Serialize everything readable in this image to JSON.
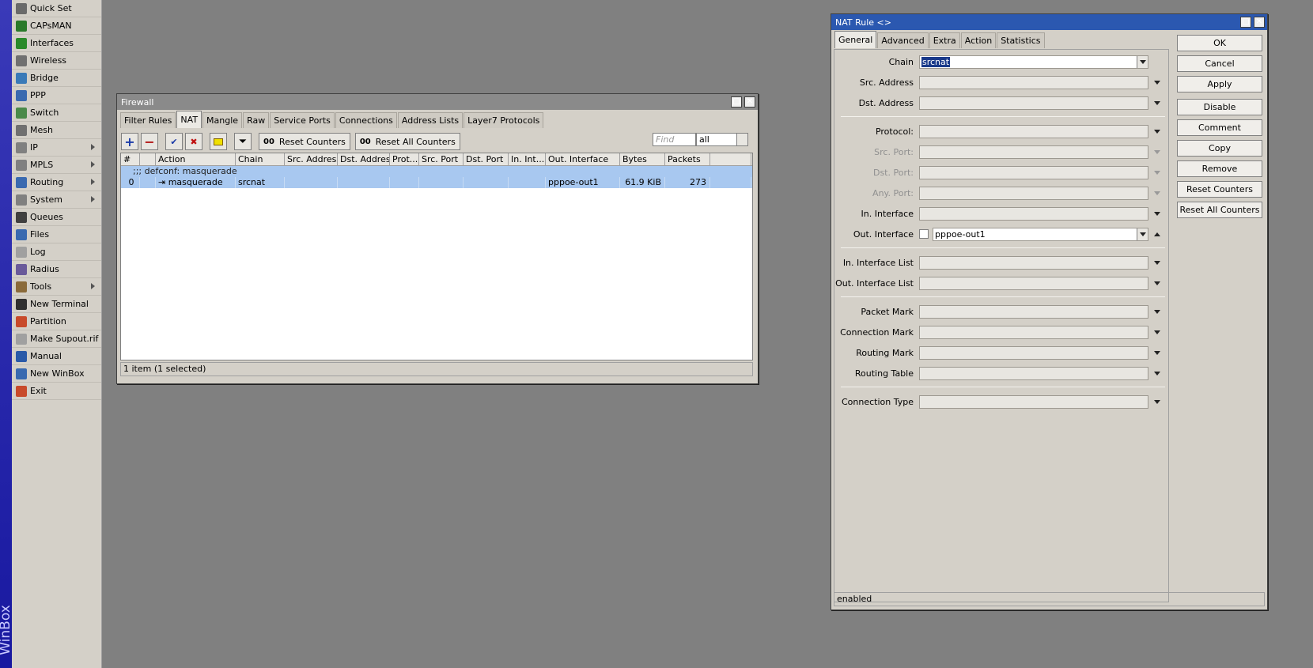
{
  "app": {
    "brand": "WinBox"
  },
  "sidebar": {
    "items": [
      {
        "label": "Quick Set",
        "icon": "quick-set-icon",
        "color": "#6a6a6a",
        "sub": false
      },
      {
        "label": "CAPsMAN",
        "icon": "capsman-icon",
        "color": "#2a7a2a",
        "sub": false
      },
      {
        "label": "Interfaces",
        "icon": "interfaces-icon",
        "color": "#2a8a2a",
        "sub": false
      },
      {
        "label": "Wireless",
        "icon": "wireless-icon",
        "color": "#707070",
        "sub": false
      },
      {
        "label": "Bridge",
        "icon": "bridge-icon",
        "color": "#3a7ab8",
        "sub": false
      },
      {
        "label": "PPP",
        "icon": "ppp-icon",
        "color": "#3a6ab0",
        "sub": false
      },
      {
        "label": "Switch",
        "icon": "switch-icon",
        "color": "#4a8a4a",
        "sub": false
      },
      {
        "label": "Mesh",
        "icon": "mesh-icon",
        "color": "#707070",
        "sub": false
      },
      {
        "label": "IP",
        "icon": "ip-icon",
        "color": "#808080",
        "sub": true
      },
      {
        "label": "MPLS",
        "icon": "mpls-icon",
        "color": "#808080",
        "sub": true
      },
      {
        "label": "Routing",
        "icon": "routing-icon",
        "color": "#3a6ab0",
        "sub": true
      },
      {
        "label": "System",
        "icon": "system-icon",
        "color": "#808080",
        "sub": true
      },
      {
        "label": "Queues",
        "icon": "queues-icon",
        "color": "#404040",
        "sub": false
      },
      {
        "label": "Files",
        "icon": "files-icon",
        "color": "#3a6ab0",
        "sub": false
      },
      {
        "label": "Log",
        "icon": "log-icon",
        "color": "#a0a0a0",
        "sub": false
      },
      {
        "label": "Radius",
        "icon": "radius-icon",
        "color": "#6a5a9a",
        "sub": false
      },
      {
        "label": "Tools",
        "icon": "tools-icon",
        "color": "#8a6a3a",
        "sub": true
      },
      {
        "label": "New Terminal",
        "icon": "terminal-icon",
        "color": "#303030",
        "sub": false
      },
      {
        "label": "Partition",
        "icon": "partition-icon",
        "color": "#c84a2a",
        "sub": false
      },
      {
        "label": "Make Supout.rif",
        "icon": "supout-icon",
        "color": "#a0a0a0",
        "sub": false
      },
      {
        "label": "Manual",
        "icon": "manual-icon",
        "color": "#2a5aa8",
        "sub": false
      },
      {
        "label": "New WinBox",
        "icon": "new-winbox-icon",
        "color": "#3a6ab0",
        "sub": false
      },
      {
        "label": "Exit",
        "icon": "exit-icon",
        "color": "#c84a2a",
        "sub": false
      }
    ]
  },
  "firewall": {
    "title": "Firewall",
    "tabs": [
      "Filter Rules",
      "NAT",
      "Mangle",
      "Raw",
      "Service Ports",
      "Connections",
      "Address Lists",
      "Layer7 Protocols"
    ],
    "active_tab": "NAT",
    "toolbar": {
      "reset_counters": "Reset Counters",
      "reset_all_counters": "Reset All Counters",
      "counter_glyph": "00",
      "find_placeholder": "Find",
      "filter_value": "all"
    },
    "columns": [
      "#",
      "",
      "Action",
      "Chain",
      "Src. Address",
      "Dst. Address",
      "Prot...",
      "Src. Port",
      "Dst. Port",
      "In. Int...",
      "Out. Interface",
      "Bytes",
      "Packets",
      ""
    ],
    "comment": ";;; defconf: masquerade",
    "rows": [
      {
        "num": "0",
        "action": "masquerade",
        "chain": "srcnat",
        "src": "",
        "dst": "",
        "proto": "",
        "sport": "",
        "dport": "",
        "in_if": "",
        "out_if": "pppoe-out1",
        "bytes": "61.9 KiB",
        "packets": "273"
      }
    ],
    "status": "1 item (1 selected)"
  },
  "nat_rule": {
    "title": "NAT Rule <>",
    "tabs": [
      "General",
      "Advanced",
      "Extra",
      "Action",
      "Statistics"
    ],
    "active_tab": "General",
    "fields": {
      "chain_label": "Chain",
      "chain_value": "srcnat",
      "src_address": "Src. Address",
      "dst_address": "Dst. Address",
      "protocol": "Protocol:",
      "src_port": "Src. Port:",
      "dst_port": "Dst. Port:",
      "any_port": "Any. Port:",
      "in_interface": "In. Interface",
      "out_interface": "Out. Interface",
      "out_interface_value": "pppoe-out1",
      "in_interface_list": "In. Interface List",
      "out_interface_list": "Out. Interface List",
      "packet_mark": "Packet Mark",
      "connection_mark": "Connection Mark",
      "routing_mark": "Routing Mark",
      "routing_table": "Routing Table",
      "connection_type": "Connection Type"
    },
    "buttons": {
      "ok": "OK",
      "cancel": "Cancel",
      "apply": "Apply",
      "disable": "Disable",
      "comment": "Comment",
      "copy": "Copy",
      "remove": "Remove",
      "reset_counters": "Reset Counters",
      "reset_all_counters": "Reset All Counters"
    },
    "status": "enabled"
  }
}
